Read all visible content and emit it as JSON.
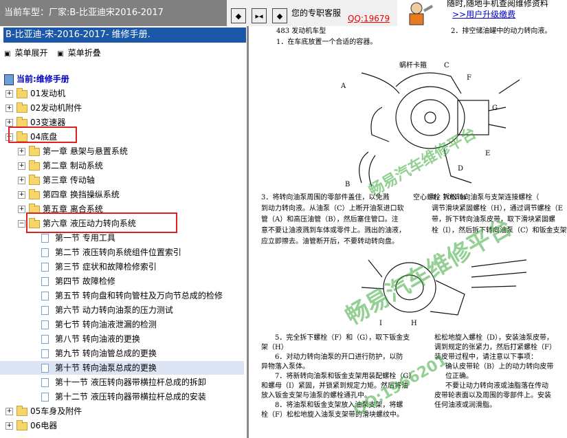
{
  "topbar": {
    "car_prefix": "当前车型：",
    "car_label": "厂家:B-比亚迪宋2016-2017",
    "buttons": [
      "◆",
      "▸◂",
      "◆"
    ],
    "service_label": "您的专职客服",
    "qq_label": "QQ:19679",
    "ad_line1": "随时,随地手机查阅维修资料",
    "ad_line2": ">>用户升级缴费"
  },
  "book": {
    "title": "B-比亚迪-宋-2016-2017- 维修手册.",
    "menu_expand": "菜单展开",
    "menu_collapse": "菜单折叠",
    "current_label": "当前:维修手册"
  },
  "tree": [
    {
      "label": "01发动机",
      "level": 0,
      "type": "folder",
      "expanded": false
    },
    {
      "label": "02发动机附件",
      "level": 0,
      "type": "folder",
      "expanded": false
    },
    {
      "label": "03变速器",
      "level": 0,
      "type": "folder",
      "expanded": false
    },
    {
      "label": "04底盘",
      "level": 0,
      "type": "folder",
      "expanded": true
    },
    {
      "label": "第一章 悬架与悬置系统",
      "level": 1,
      "type": "folder",
      "expanded": false
    },
    {
      "label": "第二章 制动系统",
      "level": 1,
      "type": "folder",
      "expanded": false
    },
    {
      "label": "第三章 传动轴",
      "level": 1,
      "type": "folder",
      "expanded": false
    },
    {
      "label": "第四章 换挡操纵系统",
      "level": 1,
      "type": "folder",
      "expanded": false
    },
    {
      "label": "第五章 离合系统",
      "level": 1,
      "type": "folder",
      "expanded": false
    },
    {
      "label": "第六章 液压动力转向系统",
      "level": 1,
      "type": "folder",
      "expanded": true
    },
    {
      "label": "第一节 专用工具",
      "level": 2,
      "type": "page"
    },
    {
      "label": "第二节 液压转向系统组件位置索引",
      "level": 2,
      "type": "page"
    },
    {
      "label": "第三节 症状和故障检修索引",
      "level": 2,
      "type": "page"
    },
    {
      "label": "第四节 故障检修",
      "level": 2,
      "type": "page"
    },
    {
      "label": "第五节 转向盘和转向管柱及万向节总成的检修",
      "level": 2,
      "type": "page"
    },
    {
      "label": "第六节 动力转向油泵的压力测试",
      "level": 2,
      "type": "page"
    },
    {
      "label": "第七节 转向油液泄漏的检测",
      "level": 2,
      "type": "page"
    },
    {
      "label": "第八节 转向油液的更换",
      "level": 2,
      "type": "page"
    },
    {
      "label": "第九节 转向油管总成的更换",
      "level": 2,
      "type": "page"
    },
    {
      "label": "第十节 转向油泵总成的更换",
      "level": 2,
      "type": "page",
      "selected": true
    },
    {
      "label": "第十一节 液压转向器带横拉杆总成的拆卸",
      "level": 2,
      "type": "page"
    },
    {
      "label": "第十二节 液压转向器带横拉杆总成的安装",
      "level": 2,
      "type": "page"
    },
    {
      "label": "05车身及附件",
      "level": 0,
      "type": "folder",
      "expanded": false
    },
    {
      "label": "06电器",
      "level": 0,
      "type": "folder",
      "expanded": false
    }
  ],
  "doc": {
    "head_left": "483 发动机车型",
    "step1": "1．在车底放置一个合适的容器。",
    "head_right": "2．排空储油罐中的动力转向液。",
    "fig1_labels": {
      "A": "A",
      "B": "B",
      "C": "C",
      "D": "D",
      "E": "E",
      "F": "F",
      "G": "G",
      "clamp": "蜗杆卡箍",
      "bolt": "空心螺栓 70N·m"
    },
    "step3": [
      "3．将转向油泵周围的零部件盖住，以免溅",
      "到动力转向液。从油泵（C）上断开油泵进口软",
      "管（A）和高压油管（B），然后塞住管口。注",
      "意不要让油液溅到车体或零件上。溅出的油液，",
      "应立即擦去。油管断开后，不要转动转向盘。"
    ],
    "step4": [
      "4．拆松转向油泵与支架连接螺栓（",
      "调节滑块紧固螺栓（H），通过调节螺栓（E",
      "带，拆下转向油泵皮带，取下滑块紧固螺",
      "栓（I），然后拆下转向油泵（C）和钣金支架（H）"
    ],
    "fig2_labels": {
      "H": "H",
      "I": "I"
    },
    "step5": [
      "5．完全拆下螺栓（F）和（G），取下钣金支",
      "架（H）",
      "6．对动力转向油泵的开口进行防护，以防",
      "异物落入泵体。",
      "7．将新转向油泵和钣金支架用装配螺栓（G）",
      "和螺母（I）紧固，并锁紧到规定力矩。然后将油",
      "放入钣金支架与油泵的螺栓通孔中。",
      "8．将油泵和钣金支架放入油泵支架，将螺",
      "栓（F）松松地旋入油泵支架带的滑块螺纹中。"
    ],
    "step9": [
      "松松地旋入螺栓（D），安装油泵皮带，",
      "调到规定的张紧力，然后打紧螺栓（F）",
      "装皮带过程中，请注意以下事项：",
      "确认皮带轮（B）上的动力转向皮带",
      "位正确。",
      "不要让动力转向液或油脂落在传动",
      "皮带轮表面以及周围的零部件上。安装",
      "任何油液或润滑脂。"
    ]
  },
  "watermarks": [
    "畅易汽车维修平台",
    "畅易汽车维修平台",
    "QQ:1966201"
  ],
  "colors": {
    "header_blue": "#1c58a8",
    "highlight_red": "#e02020",
    "link_blue": "#0000cc",
    "qq_red": "#e00000"
  }
}
